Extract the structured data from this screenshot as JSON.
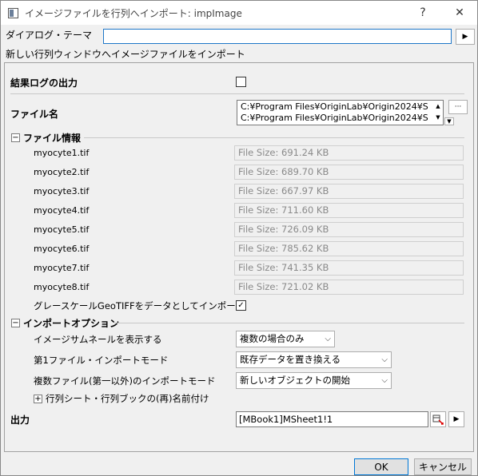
{
  "window": {
    "title": "イメージファイルを行列へインポート: impImage",
    "help": "?",
    "close": "✕"
  },
  "theme": {
    "label": "ダイアログ・テーマ",
    "value": "",
    "arrow": "▶"
  },
  "description": "新しい行列ウィンドウへイメージファイルをインポート",
  "log_output": {
    "label": "結果ログの出力",
    "checked": false
  },
  "filename": {
    "label": "ファイル名",
    "lines": [
      "C:¥Program Files¥OriginLab¥Origin2024¥S",
      "C:¥Program Files¥OriginLab¥Origin2024¥S"
    ],
    "browse": "···"
  },
  "file_info": {
    "expander": "−",
    "title": "ファイル情報",
    "files": [
      {
        "name": "myocyte1.tif",
        "size": "File Size: 691.24 KB"
      },
      {
        "name": "myocyte2.tif",
        "size": "File Size: 689.70 KB"
      },
      {
        "name": "myocyte3.tif",
        "size": "File Size: 667.97 KB"
      },
      {
        "name": "myocyte4.tif",
        "size": "File Size: 711.60 KB"
      },
      {
        "name": "myocyte5.tif",
        "size": "File Size: 726.09 KB"
      },
      {
        "name": "myocyte6.tif",
        "size": "File Size: 785.62 KB"
      },
      {
        "name": "myocyte7.tif",
        "size": "File Size: 741.35 KB"
      },
      {
        "name": "myocyte8.tif",
        "size": "File Size: 721.02 KB"
      }
    ],
    "geotiff_label": "グレースケールGeoTIFFをデータとしてインポート",
    "geotiff_checked": true
  },
  "import_options": {
    "expander": "−",
    "title": "インポートオプション",
    "thumbnail_label": "イメージサムネールを表示する",
    "thumbnail_value": "複数の場合のみ",
    "first_mode_label": "第1ファイル・インポートモード",
    "first_mode_value": "既存データを置き換える",
    "multi_mode_label": "複数ファイル(第一以外)のインポートモード",
    "multi_mode_value": "新しいオブジェクトの開始",
    "rename_expander": "+",
    "rename_label": "行列シート・行列ブックの(再)名前付け"
  },
  "output": {
    "label": "出力",
    "value": "[MBook1]MSheet1!1",
    "arrow": "▶"
  },
  "buttons": {
    "ok": "OK",
    "cancel": "キャンセル"
  }
}
